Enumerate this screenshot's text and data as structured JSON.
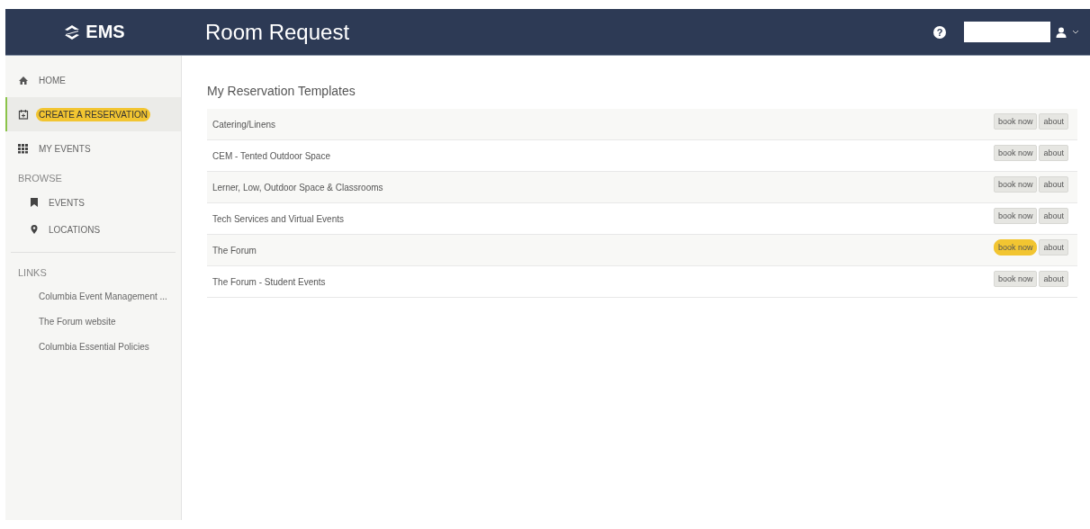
{
  "header": {
    "logo": "EMS",
    "title": "Room Request",
    "help_icon": "?"
  },
  "sidebar": {
    "nav": [
      {
        "label": "HOME",
        "selected": false,
        "highlighted": false
      },
      {
        "label": "CREATE A RESERVATION",
        "selected": true,
        "highlighted": true
      },
      {
        "label": "MY EVENTS",
        "selected": false,
        "highlighted": false
      }
    ],
    "browse": {
      "heading": "BROWSE",
      "items": [
        "EVENTS",
        "LOCATIONS"
      ]
    },
    "links": {
      "heading": "LINKS",
      "items": [
        "Columbia Event Management ...",
        "The Forum website",
        "Columbia Essential Policies"
      ]
    }
  },
  "templates": {
    "heading": "My Reservation Templates",
    "rows": [
      {
        "name": "Catering/Linens",
        "book_label": "book now",
        "about_label": "about",
        "highlighted": false
      },
      {
        "name": "CEM - Tented Outdoor Space",
        "book_label": "book now",
        "about_label": "about",
        "highlighted": false
      },
      {
        "name": "Lerner, Low, Outdoor Space & Classrooms",
        "book_label": "book now",
        "about_label": "about",
        "highlighted": false
      },
      {
        "name": "Tech Services and Virtual Events",
        "book_label": "book now",
        "about_label": "about",
        "highlighted": false
      },
      {
        "name": "The Forum",
        "book_label": "book now",
        "about_label": "about",
        "highlighted": true
      },
      {
        "name": "The Forum - Student Events",
        "book_label": "book now",
        "about_label": "about",
        "highlighted": false
      }
    ]
  }
}
